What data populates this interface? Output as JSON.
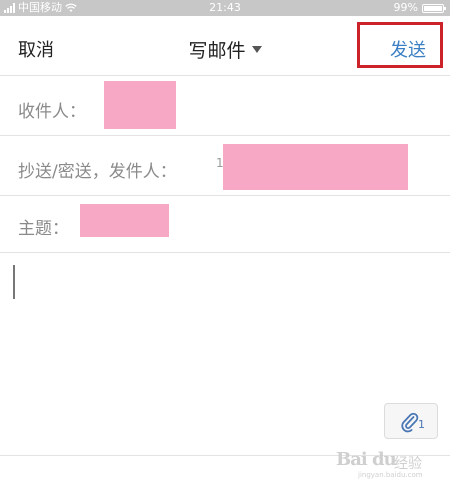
{
  "status_bar": {
    "carrier": "中国移动",
    "time": "21:43",
    "battery": "99%",
    "battery_level": 0.99
  },
  "header": {
    "cancel_label": "取消",
    "title": "写邮件",
    "send_label": "发送"
  },
  "fields": {
    "to_label": "收件人：",
    "cc_label": "抄送/密送，发件人：",
    "cc_value": "1",
    "subject_label": "主题："
  },
  "attachment": {
    "count": "1"
  },
  "watermark": {
    "logo": "Bai du",
    "text": "经验",
    "url": "jingyan.baidu.com"
  },
  "icons": {
    "wifi": "wifi-icon",
    "attach": "paperclip-icon",
    "dropdown": "caret-down-icon"
  },
  "colors": {
    "accent": "#3a7fc4",
    "highlight": "#cc2229",
    "redaction": "#f7a8c5",
    "status_bar": "#c7c7c7"
  }
}
